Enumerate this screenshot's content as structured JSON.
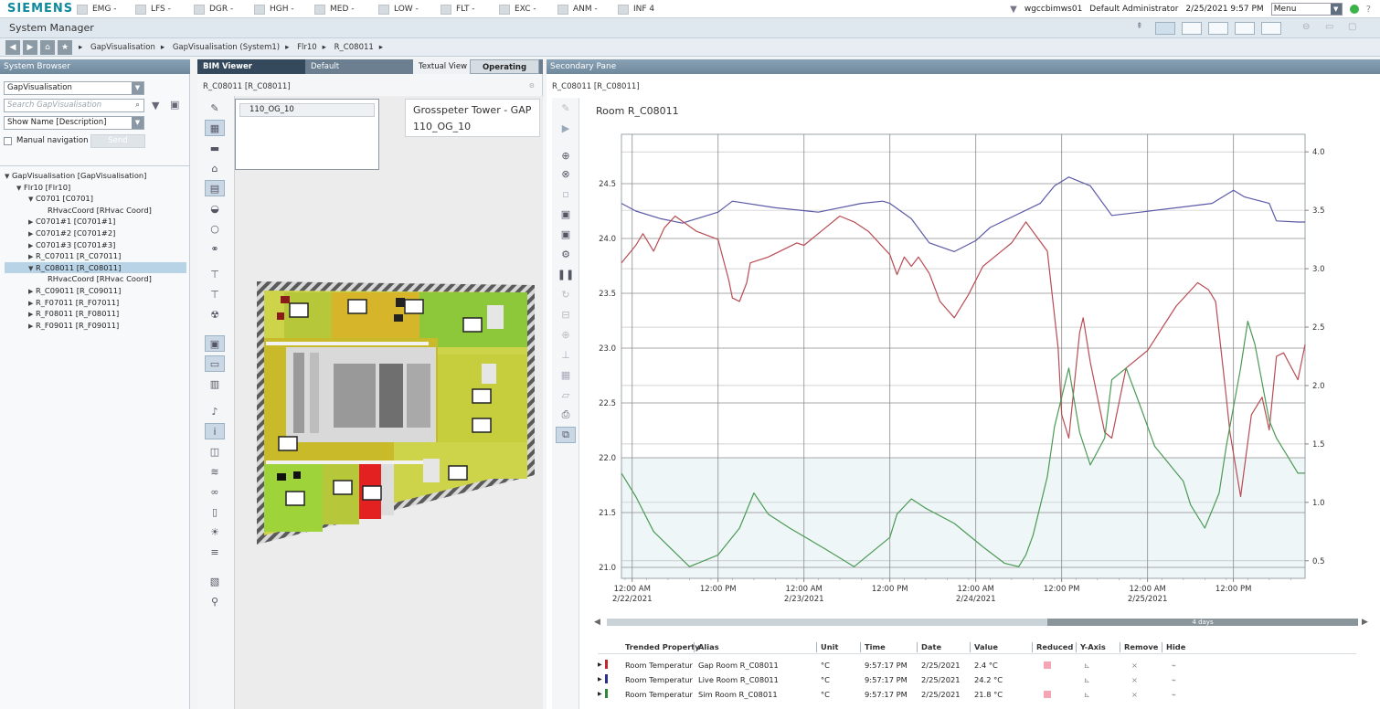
{
  "brand": "SIEMENS",
  "alarms": [
    {
      "label": "EMG -",
      "x": 84
    },
    {
      "label": "LFS -",
      "x": 148
    },
    {
      "label": "DGR -",
      "x": 212
    },
    {
      "label": "HGH -",
      "x": 278
    },
    {
      "label": "MED -",
      "x": 344
    },
    {
      "label": "LOW -",
      "x": 414
    },
    {
      "label": "FLT -",
      "x": 482
    },
    {
      "label": "EXC -",
      "x": 546
    },
    {
      "label": "ANM -",
      "x": 610
    },
    {
      "label": "INF 4",
      "x": 676
    }
  ],
  "user": {
    "host": "wgccbimws01",
    "name": "Default Administrator",
    "datetime": "2/25/2021  9:57 PM",
    "menu": "Menu"
  },
  "app_title": "System Manager",
  "breadcrumb": [
    "GapVisualisation",
    "GapVisualisation (System1)",
    "Flr10",
    "R_C08011"
  ],
  "panes": {
    "system_browser": "System Browser",
    "bim_tabs": [
      "BIM Viewer",
      "Default",
      "Textual View",
      "Operating"
    ],
    "secondary": "Secondary Pane"
  },
  "sysbrowser": {
    "view_select": "GapVisualisation",
    "search_placeholder": "Search GapVisualisation",
    "name_select": "Show Name [Description]",
    "manual_nav": "Manual navigation",
    "send": "Send",
    "tree": [
      {
        "label": "GapVisualisation [GapVisualisation]",
        "tri": "▼",
        "indent": 0
      },
      {
        "label": "Flr10 [Flr10]",
        "tri": "▼",
        "indent": 1
      },
      {
        "label": "C0701 [C0701]",
        "tri": "▼",
        "indent": 2
      },
      {
        "label": "RHvacCoord [RHvac Coord]",
        "tri": "",
        "indent": 3
      },
      {
        "label": "C0701#1 [C0701#1]",
        "tri": "▶",
        "indent": 2
      },
      {
        "label": "C0701#2 [C0701#2]",
        "tri": "▶",
        "indent": 2
      },
      {
        "label": "C0701#3 [C0701#3]",
        "tri": "▶",
        "indent": 2
      },
      {
        "label": "R_C07011 [R_C07011]",
        "tri": "▶",
        "indent": 2
      },
      {
        "label": "R_C08011 [R_C08011]",
        "tri": "▼",
        "indent": 2,
        "selected": true
      },
      {
        "label": "RHvacCoord [RHvac Coord]",
        "tri": "",
        "indent": 3
      },
      {
        "label": "R_C09011 [R_C09011]",
        "tri": "▶",
        "indent": 2
      },
      {
        "label": "R_F07011 [R_F07011]",
        "tri": "▶",
        "indent": 2
      },
      {
        "label": "R_F08011 [R_F08011]",
        "tri": "▶",
        "indent": 2
      },
      {
        "label": "R_F09011 [R_F09011]",
        "tri": "▶",
        "indent": 2
      }
    ]
  },
  "bim": {
    "object_id": "R_C08011 [R_C08011]",
    "floor": "110_OG_10",
    "label_line1": "Grosspeter Tower - GAP",
    "label_line2": "110_OG_10"
  },
  "secondary": {
    "object_id": "R_C08011 [R_C08011]",
    "chart_title": "Room R_C08011",
    "scroll_label": "4 days"
  },
  "chart_data": {
    "type": "line",
    "title": "Room R_C08011",
    "x_ticks": [
      {
        "t": 0,
        "label1": "12:00 AM",
        "label2": "2/22/2021"
      },
      {
        "t": 12,
        "label1": "12:00 PM",
        "label2": ""
      },
      {
        "t": 24,
        "label1": "12:00 AM",
        "label2": "2/23/2021"
      },
      {
        "t": 36,
        "label1": "12:00 PM",
        "label2": ""
      },
      {
        "t": 48,
        "label1": "12:00 AM",
        "label2": "2/24/2021"
      },
      {
        "t": 60,
        "label1": "12:00 PM",
        "label2": ""
      },
      {
        "t": 72,
        "label1": "12:00 AM",
        "label2": "2/25/2021"
      },
      {
        "t": 84,
        "label1": "12:00 PM",
        "label2": ""
      }
    ],
    "xlim": [
      -1.5,
      94
    ],
    "y_left": {
      "ticks": [
        21.0,
        21.5,
        22.0,
        22.5,
        23.0,
        23.5,
        24.0,
        24.5
      ],
      "lim": [
        20.9,
        24.95
      ]
    },
    "y_right": {
      "ticks": [
        0.5,
        1.0,
        1.5,
        2.0,
        2.5,
        3.0,
        3.5,
        4.0
      ],
      "lim": [
        0.35,
        4.15
      ]
    },
    "series": [
      {
        "name": "Live Room R_C08011",
        "color": "#5a5aa8",
        "axis": "left",
        "t": [
          -1.5,
          0.5,
          4,
          7,
          12,
          14,
          20,
          26,
          32,
          35,
          36,
          39,
          41.5,
          45,
          48,
          50,
          57,
          59,
          61,
          64,
          67,
          71,
          81,
          84,
          85.5,
          89,
          90,
          93,
          94
        ],
        "y": [
          24.32,
          24.25,
          24.18,
          24.14,
          24.24,
          24.34,
          24.28,
          24.24,
          24.32,
          24.34,
          24.32,
          24.18,
          23.96,
          23.88,
          23.98,
          24.1,
          24.32,
          24.48,
          24.56,
          24.48,
          24.21,
          24.24,
          24.32,
          24.44,
          24.38,
          24.32,
          24.16,
          24.15,
          24.15
        ]
      },
      {
        "name": "Gap Room R_C08011",
        "color": "#b84c54",
        "axis": "right",
        "t": [
          -1.5,
          0.5,
          1.5,
          3,
          4.5,
          6,
          9,
          12,
          13.5,
          14,
          15,
          16,
          16.5,
          19,
          23,
          24,
          27,
          29,
          31,
          33,
          36,
          37,
          38,
          39,
          40,
          41.5,
          43,
          45,
          47,
          49,
          51,
          53,
          55,
          58,
          59.5,
          60,
          61,
          62.5,
          63,
          64,
          66,
          67,
          69,
          72,
          76,
          79,
          80.5,
          81.5,
          82,
          83,
          83.5,
          85,
          86.5,
          88,
          89,
          90,
          91,
          93,
          94
        ],
        "y": [
          3.05,
          3.2,
          3.3,
          3.15,
          3.35,
          3.45,
          3.32,
          3.25,
          2.9,
          2.75,
          2.72,
          2.88,
          3.05,
          3.1,
          3.22,
          3.2,
          3.35,
          3.45,
          3.4,
          3.32,
          3.12,
          2.95,
          3.1,
          3.02,
          3.1,
          2.96,
          2.72,
          2.58,
          2.78,
          3.02,
          3.12,
          3.22,
          3.4,
          3.15,
          2.32,
          1.75,
          1.55,
          2.45,
          2.58,
          2.2,
          1.6,
          1.55,
          2.15,
          2.3,
          2.68,
          2.88,
          2.82,
          2.72,
          2.45,
          1.9,
          1.6,
          1.05,
          1.75,
          1.9,
          1.62,
          2.25,
          2.28,
          2.05,
          2.35
        ]
      },
      {
        "name": "Sim Room R_C08011",
        "color": "#4b9a55",
        "axis": "right",
        "t": [
          -1.5,
          0.5,
          3,
          8,
          12,
          15,
          17,
          19,
          22,
          27,
          31,
          36,
          37,
          39,
          41,
          45,
          49,
          52,
          54,
          55,
          56,
          58,
          59,
          61,
          62.5,
          64,
          66,
          67,
          69,
          71,
          73,
          77,
          78,
          80,
          82,
          83,
          85,
          86,
          87,
          89,
          90,
          93,
          94
        ],
        "y": [
          1.25,
          1.05,
          0.75,
          0.45,
          0.55,
          0.78,
          1.08,
          0.9,
          0.78,
          0.6,
          0.45,
          0.7,
          0.9,
          1.03,
          0.95,
          0.82,
          0.62,
          0.48,
          0.45,
          0.55,
          0.72,
          1.22,
          1.65,
          2.15,
          1.6,
          1.32,
          1.55,
          2.05,
          2.15,
          1.82,
          1.48,
          1.18,
          0.98,
          0.78,
          1.08,
          1.48,
          2.15,
          2.55,
          2.35,
          1.7,
          1.55,
          1.25,
          1.25
        ]
      }
    ]
  },
  "table": {
    "headers": [
      "Trended Property",
      "Alias",
      "Unit",
      "Time",
      "Date",
      "Value",
      "Reduced",
      "Y-Axis",
      "Remove",
      "Hide"
    ],
    "rows": [
      {
        "color": "#c0282e",
        "property": "Room Temperatur",
        "alias": "Gap Room R_C08011",
        "unit": "°C",
        "time": "9:57:17 PM",
        "date": "2/25/2021",
        "value": "2.4 °C",
        "reduced": true
      },
      {
        "color": "#2b2e8f",
        "property": "Room Temperatur",
        "alias": "Live Room R_C08011",
        "unit": "°C",
        "time": "9:57:17 PM",
        "date": "2/25/2021",
        "value": "24.2 °C",
        "reduced": false
      },
      {
        "color": "#2e8a3a",
        "property": "Room Temperatur",
        "alias": "Sim Room R_C08011",
        "unit": "°C",
        "time": "9:57:17 PM",
        "date": "2/25/2021",
        "value": "21.8 °C",
        "reduced": true
      }
    ]
  },
  "colors": {
    "accent": "#0f8a9c",
    "pane_header": "#7b93a6",
    "selection": "#b8d3e6"
  }
}
